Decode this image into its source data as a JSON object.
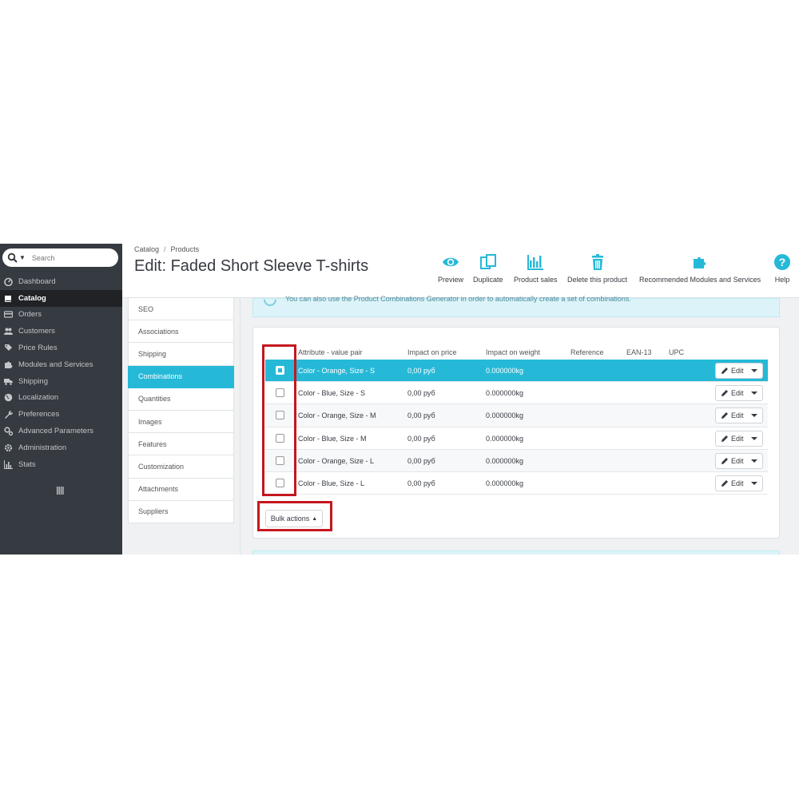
{
  "search": {
    "placeholder": "Search"
  },
  "sidebar": {
    "items": [
      {
        "label": "Dashboard",
        "icon": "dashboard-icon"
      },
      {
        "label": "Catalog",
        "icon": "book-icon"
      },
      {
        "label": "Orders",
        "icon": "credit-card-icon"
      },
      {
        "label": "Customers",
        "icon": "users-icon"
      },
      {
        "label": "Price Rules",
        "icon": "tags-icon"
      },
      {
        "label": "Modules and Services",
        "icon": "puzzle-icon"
      },
      {
        "label": "Shipping",
        "icon": "truck-icon"
      },
      {
        "label": "Localization",
        "icon": "globe-icon"
      },
      {
        "label": "Preferences",
        "icon": "wrench-icon"
      },
      {
        "label": "Advanced Parameters",
        "icon": "cogs-icon"
      },
      {
        "label": "Administration",
        "icon": "gear-icon"
      },
      {
        "label": "Stats",
        "icon": "bar-chart-icon"
      }
    ],
    "active_index": 1
  },
  "breadcrumb": {
    "first": "Catalog",
    "separator": "/",
    "second": "Products"
  },
  "page_title": "Edit: Faded Short Sleeve T-shirts",
  "toolbar": {
    "preview": "Preview",
    "duplicate": "Duplicate",
    "product_sales": "Product sales",
    "delete": "Delete this product",
    "recommended": "Recommended Modules and Services",
    "help": "Help"
  },
  "tabs": [
    "SEO",
    "Associations",
    "Shipping",
    "Combinations",
    "Quantities",
    "Images",
    "Features",
    "Customization",
    "Attachments",
    "Suppliers"
  ],
  "active_tab": "Combinations",
  "alert": {
    "text": "You can also use the   Product Combinations Generator     in order to automatically create a set of combinations."
  },
  "table": {
    "headers": {
      "attribute": "Attribute - value pair",
      "price": "Impact on price",
      "weight": "Impact on weight",
      "reference": "Reference",
      "ean": "EAN-13",
      "upc": "UPC"
    },
    "rows": [
      {
        "attribute": "Color - Orange, Size - S",
        "price": "0,00 руб",
        "weight": "0.000000kg",
        "selected": true
      },
      {
        "attribute": "Color - Blue, Size - S",
        "price": "0,00 руб",
        "weight": "0.000000kg",
        "selected": false
      },
      {
        "attribute": "Color - Orange, Size - M",
        "price": "0,00 руб",
        "weight": "0.000000kg",
        "selected": false
      },
      {
        "attribute": "Color - Blue, Size - M",
        "price": "0,00 руб",
        "weight": "0.000000kg",
        "selected": false
      },
      {
        "attribute": "Color - Orange, Size - L",
        "price": "0,00 руб",
        "weight": "0.000000kg",
        "selected": false
      },
      {
        "attribute": "Color - Blue, Size - L",
        "price": "0,00 руб",
        "weight": "0.000000kg",
        "selected": false
      }
    ],
    "edit_label": "Edit"
  },
  "bulk_actions": "Bulk actions",
  "colors": {
    "accent": "#25b9d7",
    "sidebar": "#363a41",
    "highlight": "#c4171f"
  }
}
